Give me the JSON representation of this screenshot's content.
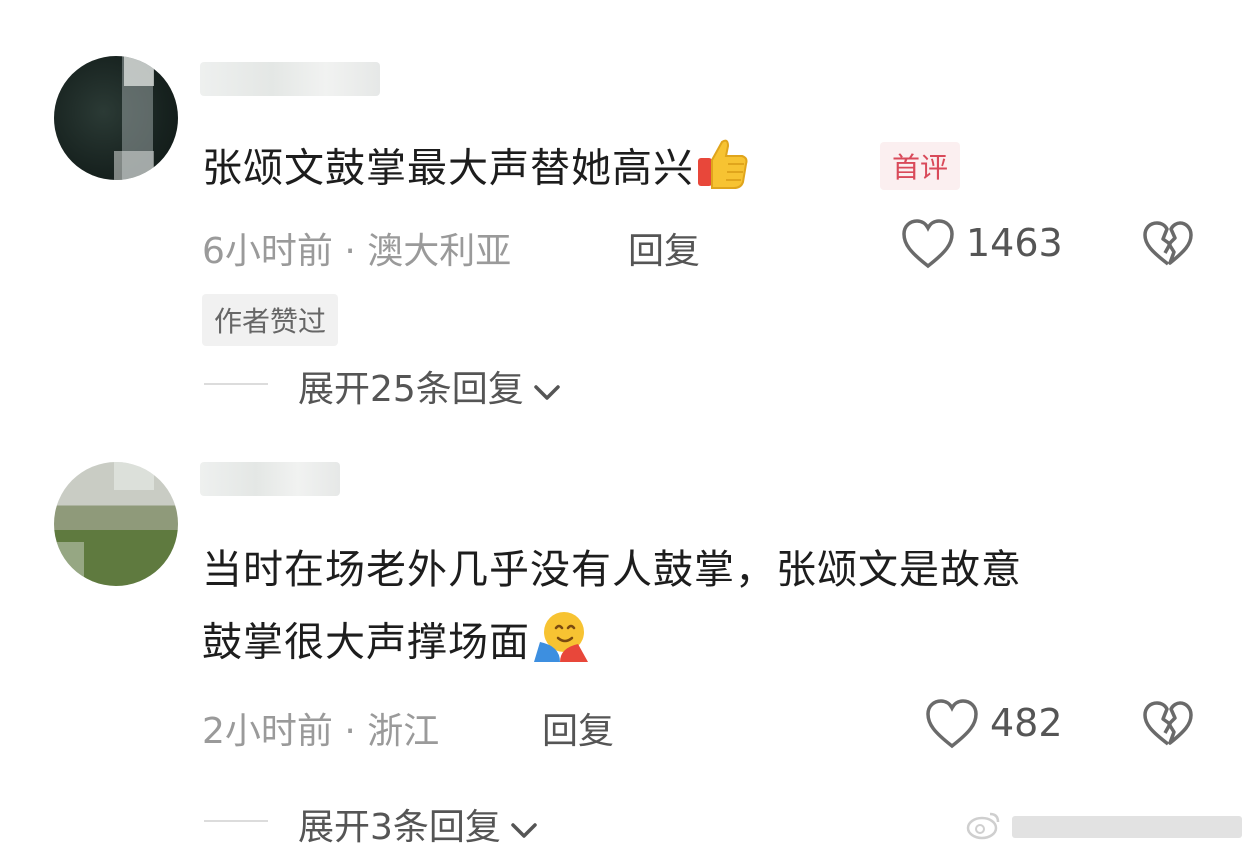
{
  "comments": [
    {
      "text": "张颂文鼓掌最大声替她高兴",
      "emoji": "thumbs-up",
      "badge": "首评",
      "meta": "6小时前 · 澳大利亚",
      "reply_label": "回复",
      "likes": "1463",
      "author_tag": "作者赞过",
      "expand_label": "展开25条回复"
    },
    {
      "text_line1": "当时在场老外几乎没有人鼓掌，张颂文是故意",
      "text_line2": "鼓掌很大声撑场面",
      "emoji": "hugging-face",
      "meta": "2小时前 · 浙江",
      "reply_label": "回复",
      "likes": "482",
      "expand_label": "展开3条回复"
    }
  ],
  "icons": {
    "like": "heart-outline-icon",
    "dislike": "broken-heart-icon",
    "expand": "chevron-down-icon",
    "watermark": "weibo-logo-icon"
  },
  "colors": {
    "badge_text": "#d94a5a",
    "badge_bg": "#fbeff0",
    "meta": "#9a9a9a"
  }
}
